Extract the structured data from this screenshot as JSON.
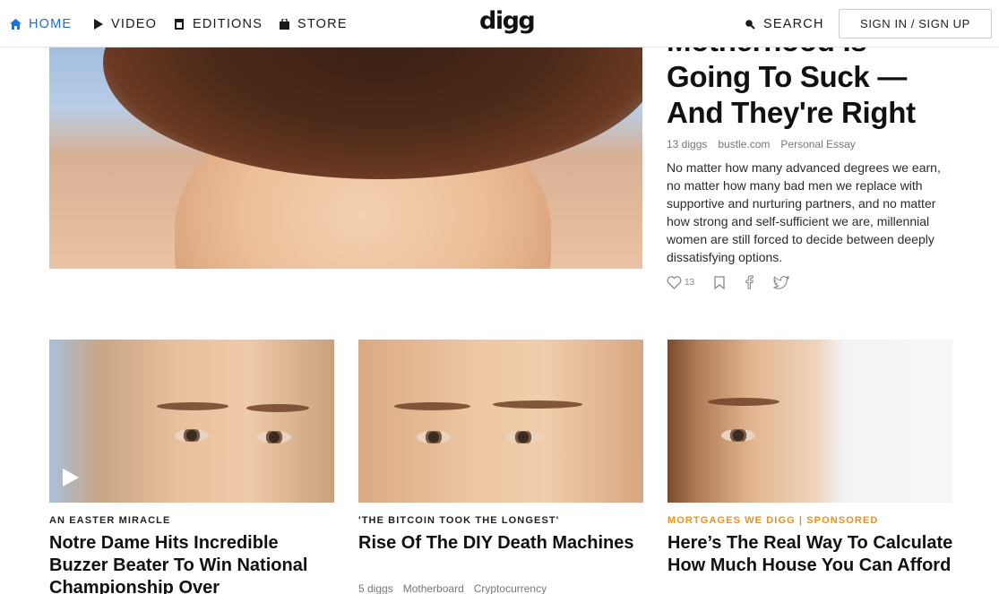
{
  "nav": {
    "home": "HOME",
    "video": "VIDEO",
    "editions": "EDITIONS",
    "store": "STORE",
    "logo": "digg",
    "search": "SEARCH",
    "signin": "SIGN IN / SIGN UP",
    "active_color": "#1b6fe0"
  },
  "hero": {
    "title_line1": "Motherhood Is",
    "title_line2": "Going To Suck —",
    "title_line3": "And They're Right",
    "diggs": "13 diggs",
    "source": "bustle.com",
    "tag": "Personal Essay",
    "description": "No matter how many advanced degrees we earn, no matter how many bad men we replace with supportive and nurturing partners, and no matter how strong and self-sufficient we are, millennial women are still forced to decide between deeply dissatisfying options.",
    "like_count": "13"
  },
  "cards": [
    {
      "kicker": "AN EASTER MIRACLE",
      "title": "Notre Dame Hits Incredible Buzzer Beater To Win National Championship Over",
      "has_video": true
    },
    {
      "kicker": "'THE BITCOIN TOOK THE LONGEST'",
      "title": "Rise Of The DIY Death Machines",
      "diggs": "5 diggs",
      "source": "Motherboard",
      "tag": "Cryptocurrency"
    },
    {
      "kicker": "MORTGAGES WE DIGG | SPONSORED",
      "title": "Here’s The Real Way To Calculate How Much House You Can Afford",
      "kicker_color": "#e8921e"
    }
  ]
}
